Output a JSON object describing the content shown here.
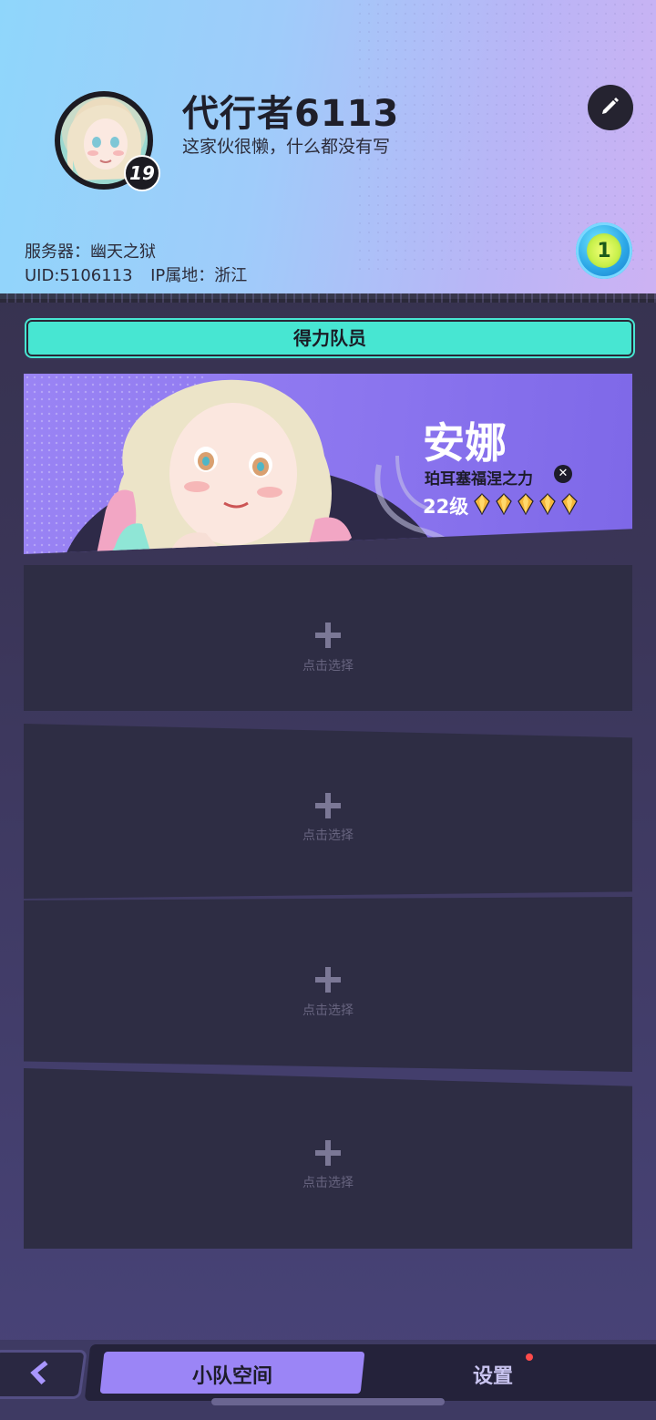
{
  "profile": {
    "username": "代行者6113",
    "signature": "这家伙很懒，什么都没有写",
    "level": "19",
    "server_label": "服务器：",
    "server_value": "幽天之狱",
    "uid_label": "UID:",
    "uid_value": "5106113",
    "ip_label": "IP属地：",
    "ip_value": "浙江",
    "medal_value": "1"
  },
  "section": {
    "title": "得力队员"
  },
  "member": {
    "name": "安娜",
    "title": "珀耳塞福涅之力",
    "level": "22级",
    "stars": 5
  },
  "empty_slot": {
    "label": "点击选择"
  },
  "bottom_nav": {
    "back_icon": "chevron-left-icon",
    "tabs": [
      {
        "label": "小队空间",
        "active": true
      },
      {
        "label": "设置",
        "active": false,
        "has_notification": true
      }
    ]
  },
  "colors": {
    "accent_teal": "#47e6d2",
    "accent_purple": "#9b85f6",
    "card_purple": "#8a74ee",
    "slot_bg": "#2e2d44",
    "notification": "#ff4b4b"
  }
}
